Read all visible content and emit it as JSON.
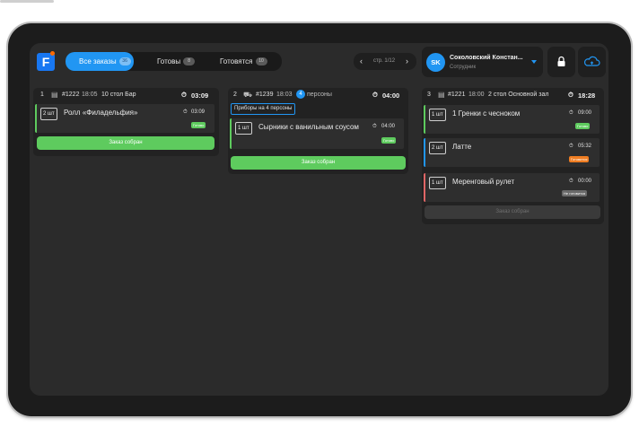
{
  "header": {
    "logo_letter": "F",
    "tabs": [
      {
        "label": "Все заказы",
        "count": "36"
      },
      {
        "label": "Готовы",
        "count": "8"
      },
      {
        "label": "Готовятся",
        "count": "10"
      }
    ],
    "pager_text": "стр. 1/12",
    "user": {
      "initials": "SK",
      "name": "Соколовский Констан...",
      "role": "Сотрудник"
    }
  },
  "orders": [
    {
      "index": "1",
      "order": "#1222",
      "time": "18:05",
      "location": "10 стол Бар",
      "timer": "03:09",
      "items": [
        {
          "qty": "2 шт",
          "name": "Ролл «Филадельфия»",
          "timer": "03:09",
          "status": "Готово",
          "status_color": "#5ecb5e"
        }
      ],
      "button": "Заказ собран"
    },
    {
      "index": "2",
      "order": "#1239",
      "time": "18:03",
      "persons_count": "4",
      "persons_label": "персоны",
      "timer": "04:00",
      "note": "Приборы на 4 персоны",
      "items": [
        {
          "qty": "1 шт",
          "name": "Сырники с ванильным соусом",
          "timer": "04:00",
          "status": "Готово",
          "status_color": "#5ecb5e"
        }
      ],
      "button": "Заказ собран"
    },
    {
      "index": "3",
      "order": "#1221",
      "time": "18:00",
      "location": "2 стол Основной зал",
      "timer": "18:28",
      "items": [
        {
          "qty": "1 шт",
          "name": "1 Гренки с чесноком",
          "timer": "09:00",
          "status": "Готово",
          "status_color": "#5ecb5e"
        },
        {
          "qty": "2 шт",
          "name": "Латте",
          "timer": "05:32",
          "status": "Готовится",
          "status_color": "#ef7d22"
        },
        {
          "qty": "1 шт",
          "name": "Меренговый рулет",
          "timer": "00:00",
          "status": "Не готовится",
          "status_color": "#6a6a6a"
        }
      ],
      "button": "Заказ собран"
    }
  ]
}
